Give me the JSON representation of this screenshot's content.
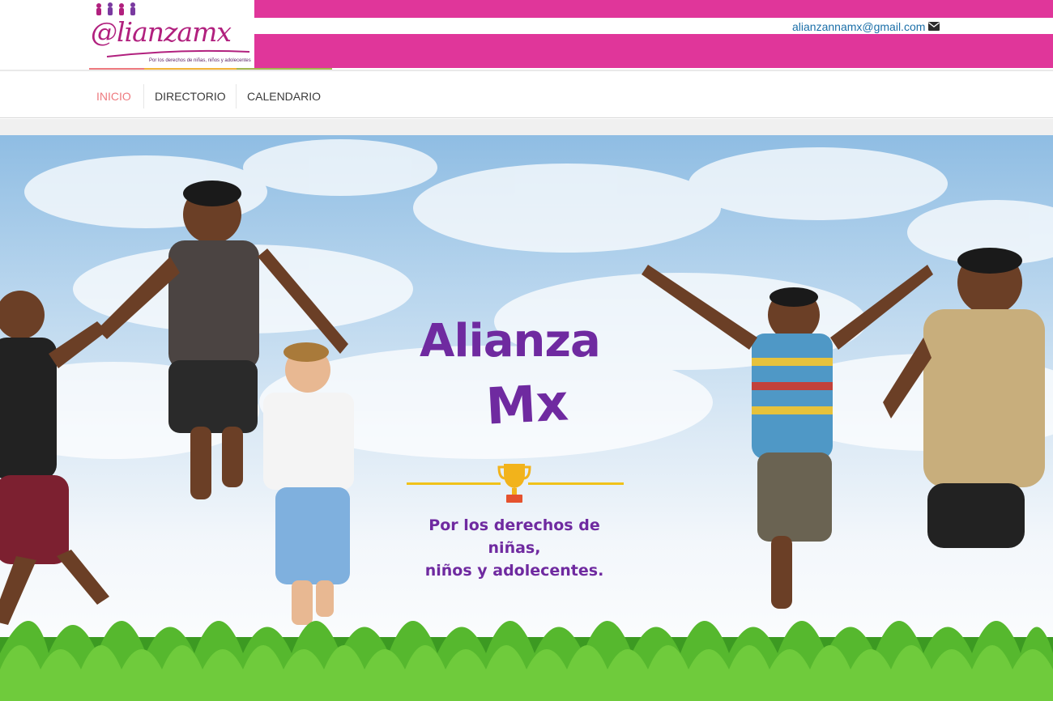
{
  "header": {
    "logo_text": "@lianzamx",
    "logo_tagline": "Por los derechos de niñas, niños y adolecentes",
    "email": "alianzannamx@gmail.com",
    "email_icon": "envelope-icon",
    "brand_color": "#e0369a"
  },
  "nav": {
    "items": [
      {
        "label": "INICIO",
        "active": true
      },
      {
        "label": "DIRECTORIO",
        "active": false
      },
      {
        "label": "CALENDARIO",
        "active": false
      }
    ],
    "active_color": "#ee7a7f"
  },
  "hero": {
    "title_line1": "Alianza",
    "title_line2": "Mx",
    "icon": "trophy-icon",
    "subtitle_line1": "Por los derechos de niñas,",
    "subtitle_line2": "niños y adolecentes.",
    "text_color": "#6f2aa0",
    "accent_color": "#f0c21a"
  }
}
